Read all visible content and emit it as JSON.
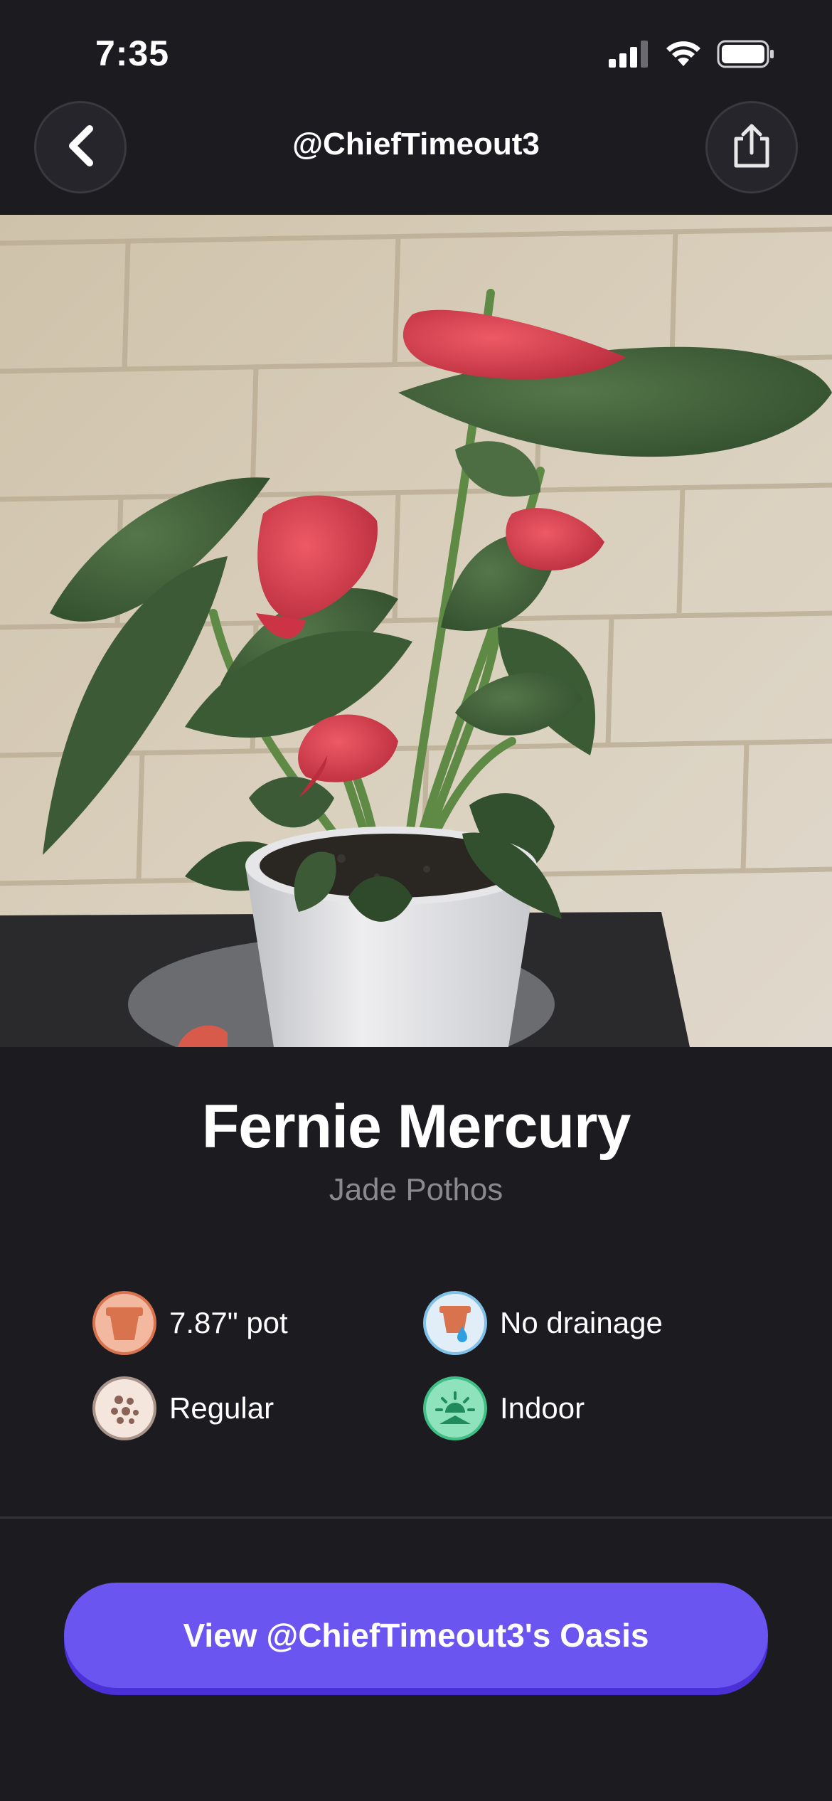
{
  "status_bar": {
    "time": "7:35",
    "signal_icon": "cellular-signal-icon",
    "wifi_icon": "wifi-icon",
    "battery_icon": "battery-icon"
  },
  "header": {
    "title": "@ChiefTimeout3",
    "back_icon": "chevron-left-icon",
    "share_icon": "share-icon"
  },
  "photo": {
    "subject": "plant-photo"
  },
  "plant": {
    "name": "Fernie Mercury",
    "species": "Jade Pothos"
  },
  "attributes": {
    "pot_size": {
      "label": "7.87\" pot",
      "icon": "pot-icon",
      "color": "#d9734d"
    },
    "drainage": {
      "label": "No drainage",
      "icon": "pot-drainage-icon",
      "color": "#d9e9f5"
    },
    "soil": {
      "label": "Regular",
      "icon": "soil-icon",
      "color": "#f1e4da"
    },
    "location": {
      "label": "Indoor",
      "icon": "sun-indoor-icon",
      "color": "#7ddcb3"
    }
  },
  "cta": {
    "label": "View @ChiefTimeout3's Oasis",
    "color": "#6b55f0"
  }
}
